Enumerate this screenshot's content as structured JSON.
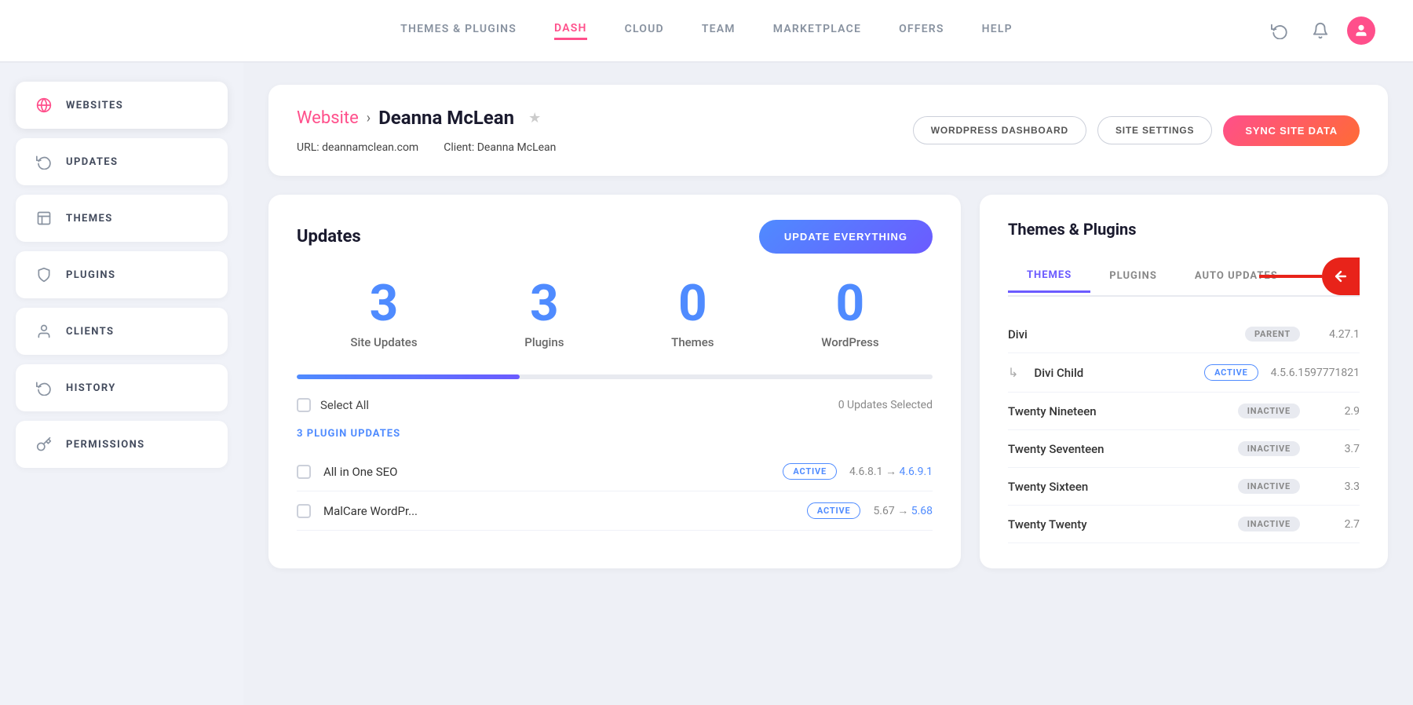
{
  "nav": {
    "links": [
      {
        "id": "themes-plugins",
        "label": "Themes & Plugins",
        "active": false
      },
      {
        "id": "dash",
        "label": "Dash",
        "active": true
      },
      {
        "id": "cloud",
        "label": "Cloud",
        "active": false
      },
      {
        "id": "team",
        "label": "Team",
        "active": false
      },
      {
        "id": "marketplace",
        "label": "Marketplace",
        "active": false
      },
      {
        "id": "offers",
        "label": "Offers",
        "active": false
      },
      {
        "id": "help",
        "label": "Help",
        "active": false
      }
    ]
  },
  "sidebar": {
    "items": [
      {
        "id": "websites",
        "label": "Websites",
        "icon": "globe",
        "active": true
      },
      {
        "id": "updates",
        "label": "Updates",
        "icon": "refresh",
        "active": false
      },
      {
        "id": "themes",
        "label": "Themes",
        "icon": "layout",
        "active": false
      },
      {
        "id": "plugins",
        "label": "Plugins",
        "icon": "shield",
        "active": false
      },
      {
        "id": "clients",
        "label": "Clients",
        "icon": "user",
        "active": false
      },
      {
        "id": "history",
        "label": "History",
        "icon": "clock",
        "active": false
      },
      {
        "id": "permissions",
        "label": "Permissions",
        "icon": "key",
        "active": false
      }
    ]
  },
  "site_header": {
    "breadcrumb_website": "Website",
    "breadcrumb_name": "Deanna McLean",
    "url_label": "URL:",
    "url_value": "deannamclean.com",
    "client_label": "Client:",
    "client_value": "Deanna McLean",
    "btn_wordpress": "WordPress Dashboard",
    "btn_settings": "Site Settings",
    "btn_sync": "Sync Site Data"
  },
  "updates": {
    "title": "Updates",
    "btn_update": "Update Everything",
    "stats": [
      {
        "number": "3",
        "label": "Site Updates"
      },
      {
        "number": "3",
        "label": "Plugins"
      },
      {
        "number": "0",
        "label": "Themes"
      },
      {
        "number": "0",
        "label": "WordPress"
      }
    ],
    "select_all_label": "Select All",
    "updates_selected": "0 Updates Selected",
    "plugin_updates_label": "3 Plugin Updates",
    "plugins": [
      {
        "name": "All in One SEO",
        "badge": "ACTIVE",
        "version_from": "4.6.8.1",
        "arrow": "→",
        "version_to": "4.6.9.1"
      },
      {
        "name": "MalCare WordPr...",
        "badge": "ACTIVE",
        "version_from": "5.67",
        "arrow": "→",
        "version_to": "5.68"
      }
    ]
  },
  "themes_plugins": {
    "title": "Themes & Plugins",
    "tabs": [
      {
        "id": "themes",
        "label": "Themes",
        "active": true
      },
      {
        "id": "plugins",
        "label": "Plugins",
        "active": false
      },
      {
        "id": "auto-updates",
        "label": "Auto Updates",
        "active": false
      }
    ],
    "themes": [
      {
        "name": "Divi",
        "badge_type": "parent",
        "badge": "PARENT",
        "version": "4.27.1",
        "child": false
      },
      {
        "name": "Divi Child",
        "badge_type": "active",
        "badge": "ACTIVE",
        "version": "4.5.6.1597771821",
        "child": true
      },
      {
        "name": "Twenty Nineteen",
        "badge_type": "inactive",
        "badge": "INACTIVE",
        "version": "2.9",
        "child": false
      },
      {
        "name": "Twenty Seventeen",
        "badge_type": "inactive",
        "badge": "INACTIVE",
        "version": "3.7",
        "child": false
      },
      {
        "name": "Twenty Sixteen",
        "badge_type": "inactive",
        "badge": "INACTIVE",
        "version": "3.3",
        "child": false
      },
      {
        "name": "Twenty Twenty",
        "badge_type": "inactive",
        "badge": "INACTIVE",
        "version": "2.7",
        "child": false
      }
    ]
  }
}
